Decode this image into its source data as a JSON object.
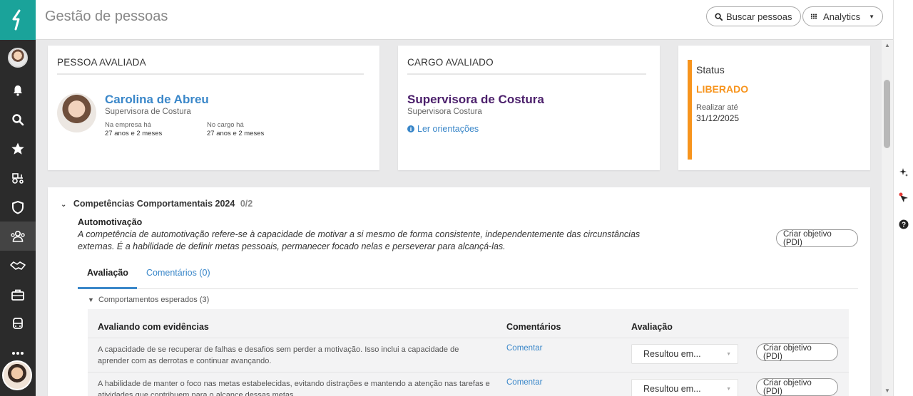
{
  "header": {
    "title": "Gestão de pessoas",
    "search_label": "Buscar pessoas",
    "analytics_label": "Analytics"
  },
  "pessoa": {
    "section_title": "PESSOA AVALIADA",
    "name": "Carolina de Abreu",
    "role": "Supervisora de Costura",
    "empresa_label": "Na empresa há",
    "empresa_value": "27 anos e 2 meses",
    "cargo_label": "No cargo há",
    "cargo_value": "27 anos e 2 meses"
  },
  "cargo": {
    "section_title": "CARGO AVALIADO",
    "name": "Supervisora de Costura",
    "sub": "Supervisora Costura",
    "link": "Ler orientações"
  },
  "status": {
    "label": "Status",
    "value": "LIBERADO",
    "due_label": "Realizar até",
    "due_date": "31/12/2025",
    "color": "#f7941d"
  },
  "competencias": {
    "title": "Competências Comportamentais 2024",
    "count": "0/2",
    "item_title": "Automotivação",
    "item_desc": "A competência de automotivação refere-se à capacidade de motivar a si mesmo de forma consistente, independentemente das circunstâncias externas. É a habilidade de definir metas pessoais, permanecer focado nelas e perseverar para alcançá-las.",
    "pdi_label": "Criar objetivo (PDI)",
    "tabs": [
      {
        "label": "Avaliação"
      },
      {
        "label": "Comentários (0)"
      }
    ],
    "expected_label": "Comportamentos esperados (3)",
    "table": {
      "headers": [
        "Avaliando com evidências",
        "Comentários",
        "Avaliação"
      ],
      "rows": [
        {
          "desc": "A capacidade de se recuperar de falhas e desafios sem perder a motivação. Isso inclui a capacidade de aprender com as derrotas e continuar avançando.",
          "comment": "Comentar",
          "select": "Resultou em...",
          "pdi": "Criar objetivo (PDI)"
        },
        {
          "desc": "A habilidade de manter o foco nas metas estabelecidas, evitando distrações e mantendo a atenção nas tarefas e atividades que contribuem para o alcance dessas metas.",
          "comment": "Comentar",
          "select": "Resultou em...",
          "pdi": "Criar objetivo (PDI)"
        }
      ]
    }
  },
  "colors": {
    "accent": "#3a87c9",
    "brand": "#1aa39a",
    "rail": "#2b2b2b"
  }
}
